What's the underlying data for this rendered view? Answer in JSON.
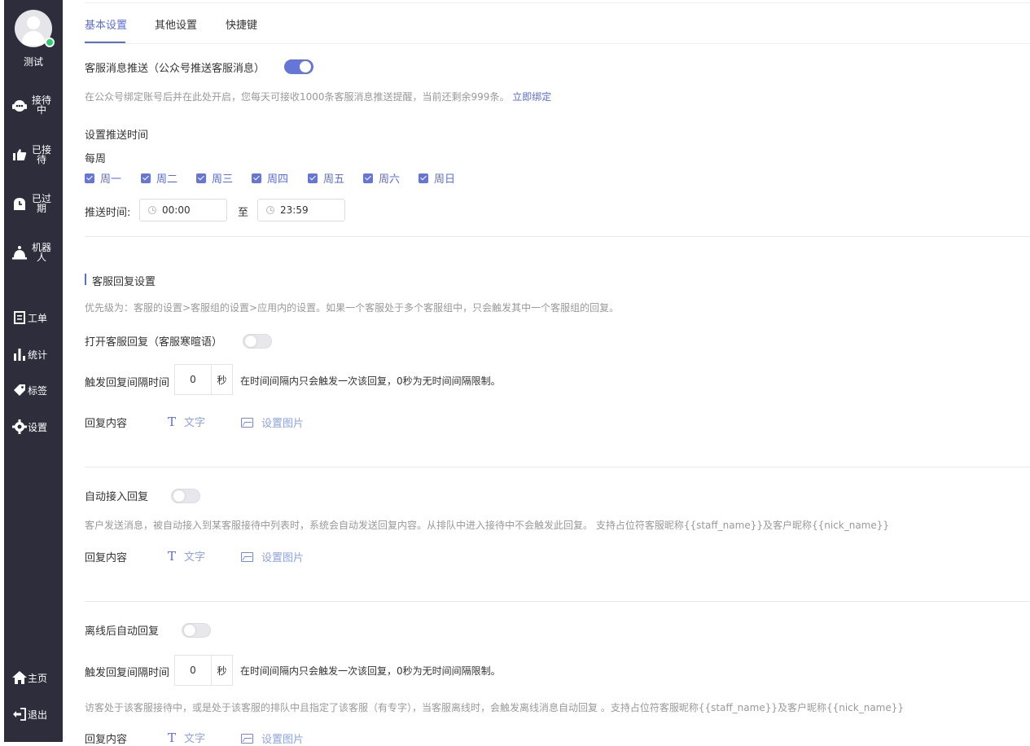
{
  "sidebar": {
    "username": "测试",
    "items": [
      {
        "label": "接待中",
        "icon": "headset-icon"
      },
      {
        "label": "已接待",
        "icon": "thumb-icon"
      },
      {
        "label": "已过期",
        "icon": "clock-bag-icon"
      },
      {
        "label": "机器人",
        "icon": "bell-robot-icon"
      },
      {
        "label": "工单",
        "icon": "ticket-icon"
      },
      {
        "label": "统计",
        "icon": "bar-chart-icon"
      },
      {
        "label": "标签",
        "icon": "tag-icon"
      },
      {
        "label": "设置",
        "icon": "gear-icon"
      },
      {
        "label": "主页",
        "icon": "home-icon"
      },
      {
        "label": "退出",
        "icon": "logout-icon"
      }
    ]
  },
  "tabs": [
    "基本设置",
    "其他设置",
    "快捷键"
  ],
  "push": {
    "title": "客服消息推送（公众号推送客服消息）",
    "enabled": true,
    "hint": "在公众号绑定账号后并在此处开启，您每天可接收1000条客服消息推送提醒，当前还剩余999条。",
    "bind_link": "立即绑定",
    "schedule_label": "设置推送时间",
    "weekly_label": "每周",
    "days": [
      "周一",
      "周二",
      "周三",
      "周四",
      "周五",
      "周六",
      "周日"
    ],
    "time_label": "推送时间:",
    "start_time": "00:00",
    "to_label": "至",
    "end_time": "23:59"
  },
  "reply": {
    "section_title": "客服回复设置",
    "priority_hint": "优先级为：客服的设置>客服组的设置>应用内的设置。如果一个客服处于多个客服组中，只会触发其中一个客服组的回复。",
    "greeting_label": "打开客服回复（客服寒暄语）",
    "greeting_enabled": false,
    "interval_label": "触发回复间隔时间",
    "interval_value": "0",
    "interval_unit": "秒",
    "interval_hint": "在时间间隔内只会触发一次该回复，0秒为无时间间隔限制。",
    "content_label": "回复内容",
    "text_option": "文字",
    "image_option": "设置图片"
  },
  "auto_accept": {
    "label": "自动接入回复",
    "enabled": false,
    "hint": "客户发送消息，被自动接入到某客服接待中列表时，系统会自动发送回复内容。从排队中进入接待中不会触发此回复。 支持占位符客服昵称{{staff_name}}及客户昵称{{nick_name}}",
    "content_label": "回复内容",
    "text_option": "文字",
    "image_option": "设置图片"
  },
  "offline": {
    "label": "离线后自动回复",
    "enabled": false,
    "interval_label": "触发回复间隔时间",
    "interval_value": "0",
    "interval_unit": "秒",
    "interval_hint": "在时间间隔内只会触发一次该回复，0秒为无时间间隔限制。",
    "hint": "访客处于该客服接待中，或是处于该客服的排队中且指定了该客服（有专字），当客服离线时，会触发离线消息自动回复 。支持占位符客服昵称{{staff_name}}及客户昵称{{nick_name}}",
    "content_label": "回复内容",
    "text_option": "文字",
    "image_option": "设置图片"
  },
  "colors": {
    "sidebar_bg": "#2d2d3c",
    "accent": "#5b6dd6",
    "online": "#2ecc71"
  }
}
